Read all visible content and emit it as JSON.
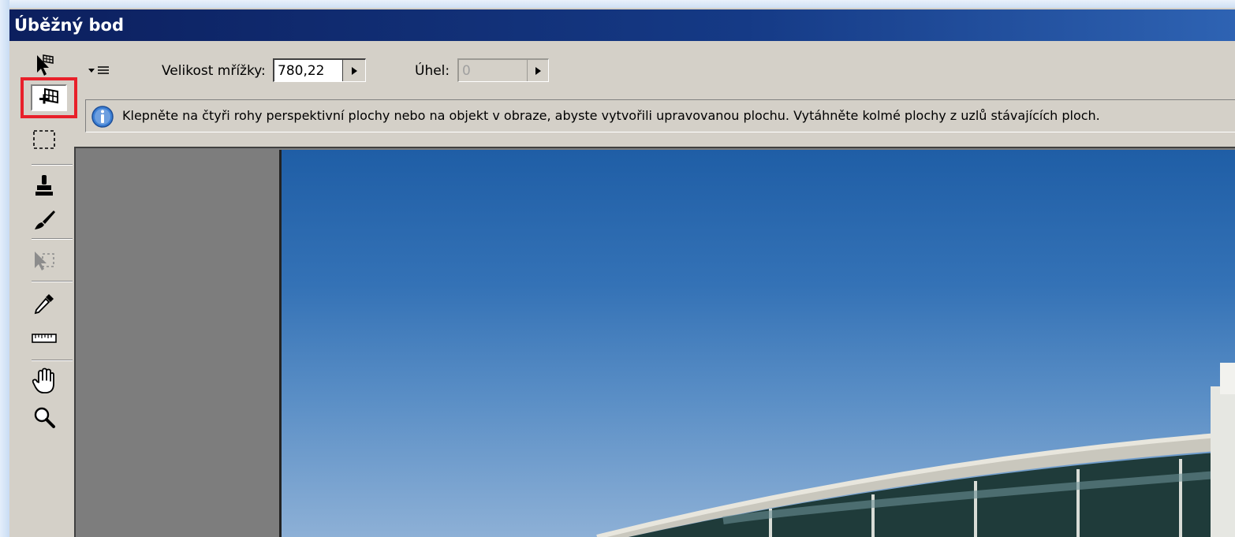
{
  "window": {
    "title": "Úběžný bod"
  },
  "toolbar": {
    "tools": [
      {
        "name": "edit-plane-tool",
        "icon": "arrow-plane-icon",
        "selected": false
      },
      {
        "name": "create-plane-tool",
        "icon": "create-plane-icon",
        "selected": true
      },
      {
        "name": "marquee-tool",
        "icon": "marquee-icon",
        "selected": false
      },
      {
        "name": "stamp-tool",
        "icon": "stamp-icon",
        "selected": false
      },
      {
        "name": "brush-tool",
        "icon": "brush-icon",
        "selected": false
      },
      {
        "name": "transform-tool",
        "icon": "transform-icon",
        "selected": false,
        "disabled": true
      },
      {
        "name": "eyedropper-tool",
        "icon": "eyedropper-icon",
        "selected": false
      },
      {
        "name": "measure-tool",
        "icon": "ruler-icon",
        "selected": false
      },
      {
        "name": "hand-tool",
        "icon": "hand-icon",
        "selected": false
      },
      {
        "name": "zoom-tool",
        "icon": "zoom-icon",
        "selected": false
      }
    ],
    "highlight_color": "#e8202a"
  },
  "options": {
    "menu_icon": "flyout-menu-icon",
    "grid_size_label": "Velikost mřížky:",
    "grid_size_value": "780,22",
    "angle_label": "Úhel:",
    "angle_value": "0",
    "angle_disabled": true
  },
  "info": {
    "icon": "info-icon",
    "text": "Klepněte na čtyři rohy perspektivní plochy nebo na objekt v obraze, abyste vytvořili upravovanou plochu. Vytáhněte kolmé plochy z uzlů stávajících ploch."
  },
  "canvas": {
    "background": "#7d7d7d",
    "image": "photo-building-sky"
  }
}
